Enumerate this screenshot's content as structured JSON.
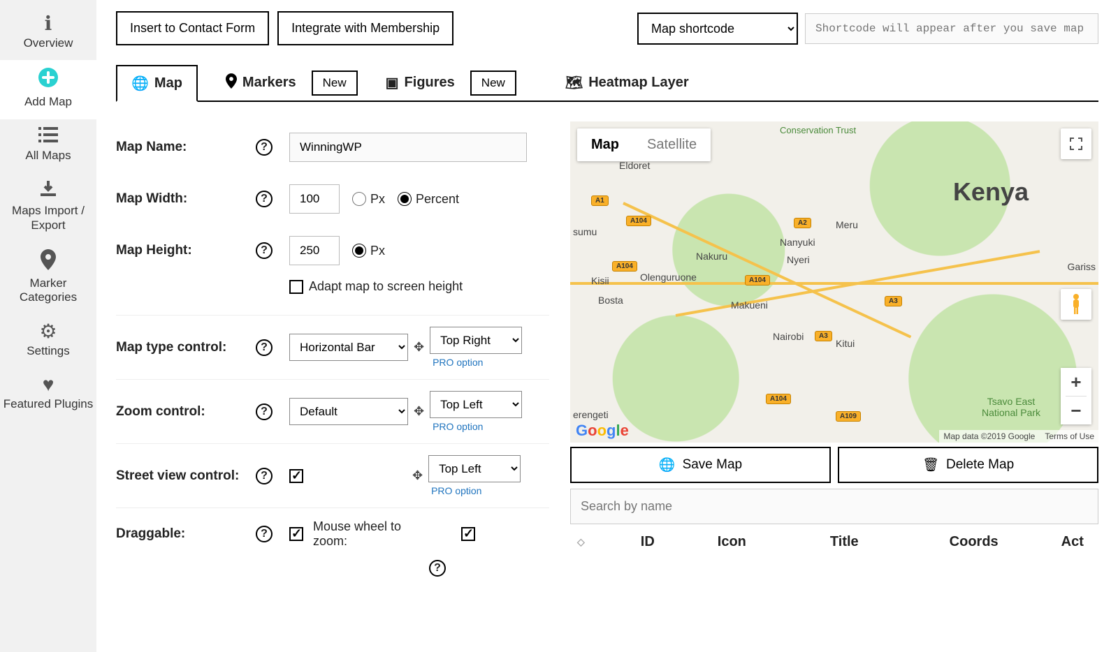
{
  "sidebar": {
    "items": [
      {
        "label": "Overview"
      },
      {
        "label": "Add Map"
      },
      {
        "label": "All Maps"
      },
      {
        "label": "Maps Import / Export"
      },
      {
        "label": "Marker Categories"
      },
      {
        "label": "Settings"
      },
      {
        "label": "Featured Plugins"
      }
    ]
  },
  "toolbar": {
    "insert_contact": "Insert to Contact Form",
    "integrate_membership": "Integrate with Membership",
    "shortcode_select": "Map shortcode",
    "shortcode_placeholder": "Shortcode will appear after you save map"
  },
  "tabs": {
    "map": "Map",
    "markers": "Markers",
    "figures": "Figures",
    "heatmap": "Heatmap Layer",
    "new": "New"
  },
  "form": {
    "map_name_label": "Map Name:",
    "map_name_value": "WinningWP",
    "map_width_label": "Map Width:",
    "map_width_value": "100",
    "px": "Px",
    "percent": "Percent",
    "map_height_label": "Map Height:",
    "map_height_value": "250",
    "adapt_label": "Adapt map to screen height",
    "map_type_control_label": "Map type control:",
    "map_type_control_value": "Horizontal Bar",
    "map_type_control_pos": "Top Right",
    "zoom_control_label": "Zoom control:",
    "zoom_control_value": "Default",
    "zoom_control_pos": "Top Left",
    "street_view_label": "Street view control:",
    "street_view_pos": "Top Left",
    "draggable_label": "Draggable:",
    "mouse_wheel_label": "Mouse wheel to zoom:",
    "pro_option": "PRO option"
  },
  "map": {
    "map_btn": "Map",
    "satellite_btn": "Satellite",
    "country": "Kenya",
    "cities": {
      "nairobi": "Nairobi",
      "nakuru": "Nakuru",
      "eldoret": "Eldoret",
      "kisii": "Kisii",
      "nyeri": "Nyeri",
      "meru": "Meru",
      "nanyuki": "Nanyuki",
      "kitui": "Kitui",
      "garissa": "Gariss",
      "bosta": "Bosta",
      "serengeti": "erengeti",
      "makueni": "Makueni",
      "olenguruone": "Olenguruone",
      "isumu": "sumu"
    },
    "parks": {
      "cons_trust": "Conservation Trust",
      "tsavo": "Tsavo East National Park"
    },
    "shields": {
      "a1": "A1",
      "a2": "A2",
      "a3": "A3",
      "a104": "A104",
      "a109": "A109"
    },
    "attribution": "Map data ©2019 Google",
    "terms": "Terms of Use",
    "save": "Save Map",
    "delete": "Delete Map",
    "search_placeholder": "Search by name"
  },
  "table": {
    "id": "ID",
    "icon": "Icon",
    "title": "Title",
    "coords": "Coords",
    "actions": "Act"
  }
}
